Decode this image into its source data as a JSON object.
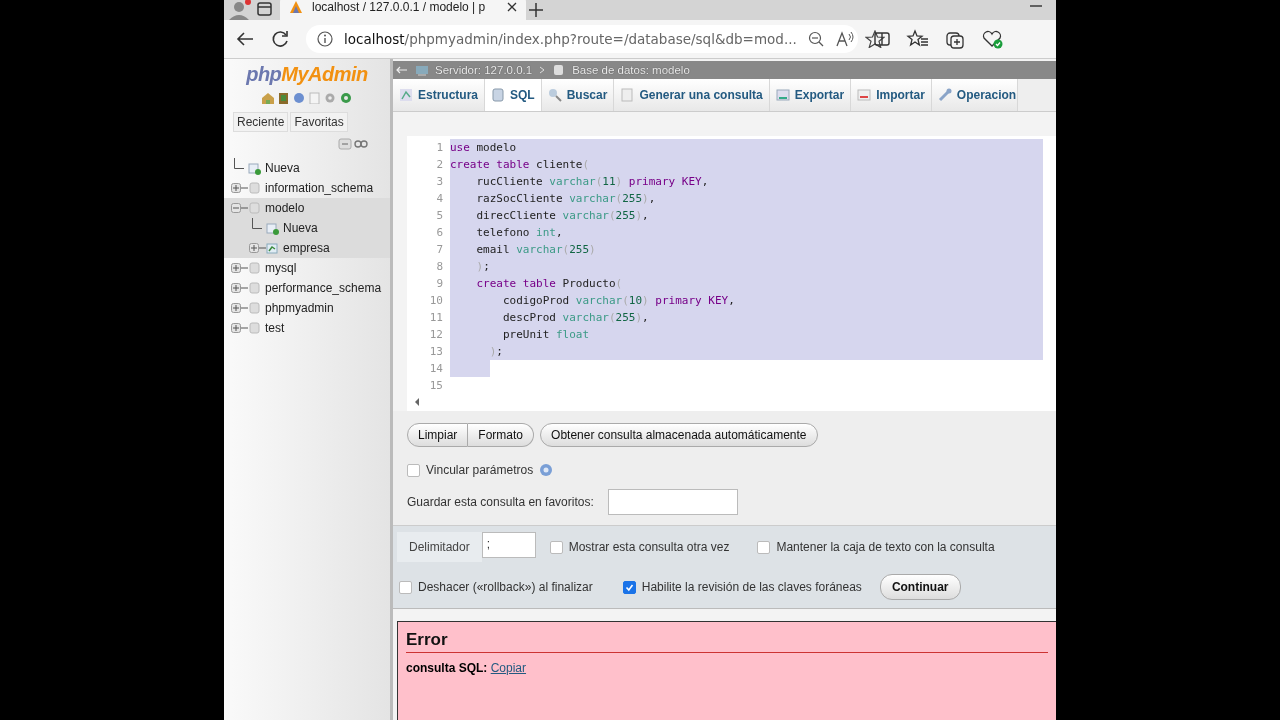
{
  "browser": {
    "tab_title": "localhost / 127.0.0.1 / modelo | p",
    "address": {
      "host": "localhost",
      "path": "/phpmyadmin/index.php?route=/database/sql&db=mod..."
    }
  },
  "sidebar": {
    "logo": {
      "first": "php",
      "second": "MyAdmin"
    },
    "tabs": [
      {
        "label": "Reciente"
      },
      {
        "label": "Favoritas"
      }
    ],
    "tree": [
      {
        "label": "Nueva",
        "kind": "new",
        "selected": false
      },
      {
        "label": "information_schema",
        "kind": "db",
        "expanded": false,
        "selected": false
      },
      {
        "label": "modelo",
        "kind": "db",
        "expanded": true,
        "selected": true,
        "children": [
          {
            "label": "Nueva",
            "kind": "new",
            "selected": false
          },
          {
            "label": "empresa",
            "kind": "table",
            "expanded": false,
            "selected": false
          }
        ]
      },
      {
        "label": "mysql",
        "kind": "db",
        "expanded": false,
        "selected": false
      },
      {
        "label": "performance_schema",
        "kind": "db",
        "expanded": false,
        "selected": false
      },
      {
        "label": "phpmyadmin",
        "kind": "db",
        "expanded": false,
        "selected": false
      },
      {
        "label": "test",
        "kind": "db",
        "expanded": false,
        "selected": false
      }
    ]
  },
  "breadcrumb": [
    {
      "label": "Servidor: 127.0.0.1",
      "kind": "server"
    },
    {
      "label": "Base de datos: modelo",
      "kind": "database"
    }
  ],
  "tabs": [
    {
      "label": "Estructura",
      "kind": "structure",
      "selected": false
    },
    {
      "label": "SQL",
      "kind": "sql",
      "selected": true
    },
    {
      "label": "Buscar",
      "kind": "search",
      "selected": false
    },
    {
      "label": "Generar una consulta",
      "kind": "query",
      "selected": false
    },
    {
      "label": "Exportar",
      "kind": "export",
      "selected": false
    },
    {
      "label": "Importar",
      "kind": "import",
      "selected": false
    },
    {
      "label": "Operacion",
      "kind": "operations",
      "selected": false
    }
  ],
  "editor": {
    "lines": [
      {
        "number": "1",
        "selected": true,
        "tokens": [
          {
            "text": "use",
            "kind": "keyword"
          },
          {
            "text": " modelo",
            "kind": "plain"
          }
        ]
      },
      {
        "number": "2",
        "selected": true,
        "tokens": [
          {
            "text": "create table",
            "kind": "keyword"
          },
          {
            "text": " cliente",
            "kind": "plain"
          },
          {
            "text": "(",
            "kind": "paren"
          }
        ]
      },
      {
        "number": "3",
        "selected": true,
        "tokens": [
          {
            "text": "    rucCliente ",
            "kind": "plain"
          },
          {
            "text": "varchar",
            "kind": "type"
          },
          {
            "text": "(",
            "kind": "paren"
          },
          {
            "text": "11",
            "kind": "number"
          },
          {
            "text": ")",
            "kind": "paren"
          },
          {
            "text": " primary KEY",
            "kind": "keyword"
          },
          {
            "text": ",",
            "kind": "plain"
          }
        ]
      },
      {
        "number": "4",
        "selected": true,
        "tokens": [
          {
            "text": "    razSocCliente ",
            "kind": "plain"
          },
          {
            "text": "varchar",
            "kind": "type"
          },
          {
            "text": "(",
            "kind": "paren"
          },
          {
            "text": "255",
            "kind": "number"
          },
          {
            "text": ")",
            "kind": "paren"
          },
          {
            "text": ",",
            "kind": "plain"
          }
        ]
      },
      {
        "number": "5",
        "selected": true,
        "tokens": [
          {
            "text": "    direcCliente ",
            "kind": "plain"
          },
          {
            "text": "varchar",
            "kind": "type"
          },
          {
            "text": "(",
            "kind": "paren"
          },
          {
            "text": "255",
            "kind": "number"
          },
          {
            "text": ")",
            "kind": "paren"
          },
          {
            "text": ",",
            "kind": "plain"
          }
        ]
      },
      {
        "number": "6",
        "selected": true,
        "tokens": [
          {
            "text": "    telefono ",
            "kind": "plain"
          },
          {
            "text": "int",
            "kind": "type"
          },
          {
            "text": ",",
            "kind": "plain"
          }
        ]
      },
      {
        "number": "7",
        "selected": true,
        "tokens": [
          {
            "text": "    email ",
            "kind": "plain"
          },
          {
            "text": "varchar",
            "kind": "type"
          },
          {
            "text": "(",
            "kind": "paren"
          },
          {
            "text": "255",
            "kind": "number"
          },
          {
            "text": ")",
            "kind": "paren"
          }
        ]
      },
      {
        "number": "8",
        "selected": true,
        "tokens": [
          {
            "text": "    )",
            "kind": "paren"
          },
          {
            "text": ";",
            "kind": "plain"
          }
        ]
      },
      {
        "number": "9",
        "selected": true,
        "tokens": [
          {
            "text": "    create table",
            "kind": "keyword"
          },
          {
            "text": " Producto",
            "kind": "plain"
          },
          {
            "text": "(",
            "kind": "paren"
          }
        ]
      },
      {
        "number": "10",
        "selected": true,
        "tokens": [
          {
            "text": "        codigoProd ",
            "kind": "plain"
          },
          {
            "text": "varchar",
            "kind": "type"
          },
          {
            "text": "(",
            "kind": "paren"
          },
          {
            "text": "10",
            "kind": "number"
          },
          {
            "text": ")",
            "kind": "paren"
          },
          {
            "text": " primary KEY",
            "kind": "keyword"
          },
          {
            "text": ",",
            "kind": "plain"
          }
        ]
      },
      {
        "number": "11",
        "selected": true,
        "tokens": [
          {
            "text": "        descProd ",
            "kind": "plain"
          },
          {
            "text": "varchar",
            "kind": "type"
          },
          {
            "text": "(",
            "kind": "paren"
          },
          {
            "text": "255",
            "kind": "number"
          },
          {
            "text": ")",
            "kind": "paren"
          },
          {
            "text": ",",
            "kind": "plain"
          }
        ]
      },
      {
        "number": "12",
        "selected": true,
        "tokens": [
          {
            "text": "        preUnit ",
            "kind": "plain"
          },
          {
            "text": "float",
            "kind": "type"
          }
        ]
      },
      {
        "number": "13",
        "selected": true,
        "tokens": [
          {
            "text": "      )",
            "kind": "paren"
          },
          {
            "text": ";",
            "kind": "plain"
          }
        ]
      },
      {
        "number": "14",
        "selected": true
      },
      {
        "number": "15",
        "selected": false
      }
    ]
  },
  "editor_buttons": [
    {
      "label": "Limpiar",
      "kind": "joined"
    },
    {
      "label": "Formato",
      "kind": "joined"
    },
    {
      "label": "Obtener consulta almacenada automáticamente",
      "kind": "single"
    }
  ],
  "bind_parameters": {
    "label": "Vincular parámetros",
    "checked": false
  },
  "bookmark": {
    "label": "Guardar esta consulta en favoritos:"
  },
  "options": {
    "delimiter_label": "Delimitador",
    "delimiter_value": ";",
    "checkboxes": [
      {
        "label": "Mostrar esta consulta otra vez",
        "checked": false
      },
      {
        "label": "Mantener la caja de texto con la consulta",
        "checked": false
      },
      {
        "label": "Deshacer («rollback») al finalizar",
        "checked": false
      },
      {
        "label": "Habilite la revisión de las claves foráneas",
        "checked": true
      }
    ],
    "submit": "Continuar"
  },
  "error": {
    "title": "Error",
    "query_label": "consulta SQL:",
    "link": "Copiar"
  }
}
